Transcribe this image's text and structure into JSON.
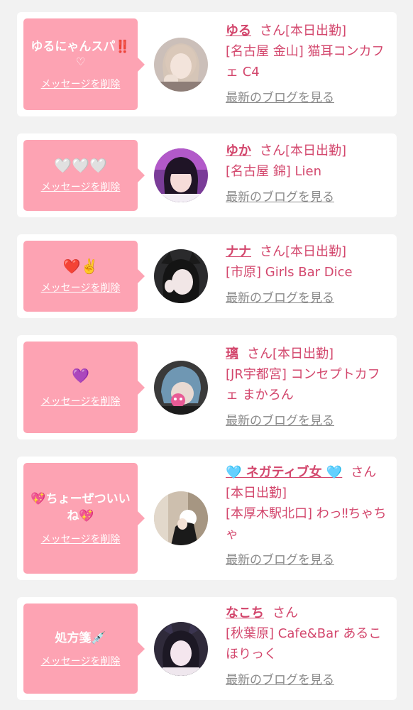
{
  "delete_label": "メッセージを削除",
  "blog_label": "最新のブログを見る",
  "honorific": "さん",
  "status_label": "[本日出勤]",
  "colors": {
    "bubble": "#fda3b3",
    "accent": "#d3476d",
    "link_gray": "#8a8a8a"
  },
  "cards": [
    {
      "message": "ゆるにゃんスパ‼️",
      "message_sub": "♡",
      "name": "ゆる",
      "shop": "[名古屋 金山] 猫耳コンカフェ C4"
    },
    {
      "message": "🤍🤍🤍",
      "message_sub": "",
      "name": "ゆか",
      "shop": "[名古屋 錦] Lien"
    },
    {
      "message": "❤️✌️",
      "message_sub": "",
      "name": "ナナ",
      "shop": "[市原] Girls Bar Dice"
    },
    {
      "message": "💜",
      "message_sub": "",
      "name": "璃",
      "shop": "[JR宇都宮] コンセプトカフェ まかろん"
    },
    {
      "message": "💖ちょーぜついいね💖",
      "message_sub": "",
      "name": "🩵 ネガティブ女 🩵",
      "shop": "[本厚木駅北口] わっ‼ちゃちゃ"
    },
    {
      "message": "処方箋💉",
      "message_sub": "",
      "name": "なこち",
      "shop": "[秋葉原] Cafe&Bar あるこほりっく"
    }
  ]
}
